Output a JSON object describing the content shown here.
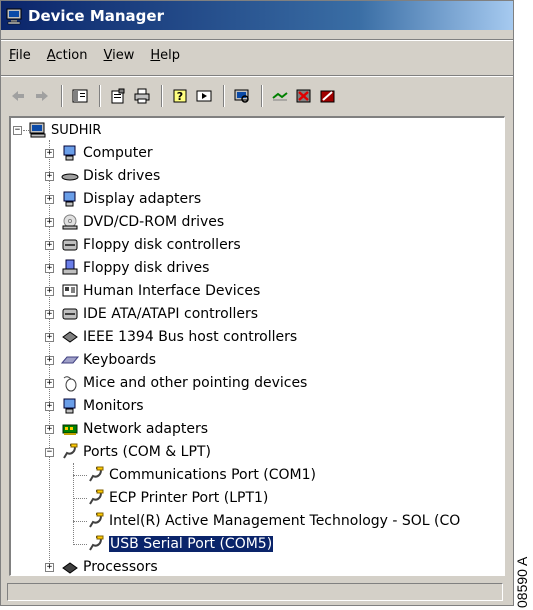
{
  "window": {
    "title": "Device Manager"
  },
  "menu": [
    {
      "label_acc": "F",
      "label_rest": "ile"
    },
    {
      "label_acc": "A",
      "label_rest": "ction"
    },
    {
      "label_acc": "V",
      "label_rest": "iew"
    },
    {
      "label_acc": "H",
      "label_rest": "elp"
    }
  ],
  "toolbar": {
    "buttons": [
      "back-icon",
      "forward-icon",
      "show-hide-tree-icon",
      "properties-icon",
      "print-icon",
      "help-icon",
      "run-icon",
      "scan-hardware-icon",
      "update-driver-icon",
      "uninstall-icon",
      "disable-icon"
    ]
  },
  "tree": {
    "root": "SUDHIR",
    "categories": [
      "Computer",
      "Disk drives",
      "Display adapters",
      "DVD/CD-ROM drives",
      "Floppy disk controllers",
      "Floppy disk drives",
      "Human Interface Devices",
      "IDE ATA/ATAPI controllers",
      "IEEE 1394 Bus host controllers",
      "Keyboards",
      "Mice and other pointing devices",
      "Monitors",
      "Network adapters",
      "Ports (COM & LPT)"
    ],
    "ports_children": [
      "Communications Port (COM1)",
      "ECP Printer Port (LPT1)",
      "Intel(R) Active Management Technology - SOL (CO",
      "USB Serial Port (COM5)"
    ],
    "after": [
      "Processors"
    ],
    "selected": "USB Serial Port (COM5)"
  },
  "side_code": "08590 A",
  "colors": {
    "title_start": "#0a246a",
    "title_end": "#a6caf0",
    "selection": "#0a246a",
    "chrome": "#d4d0c8"
  }
}
